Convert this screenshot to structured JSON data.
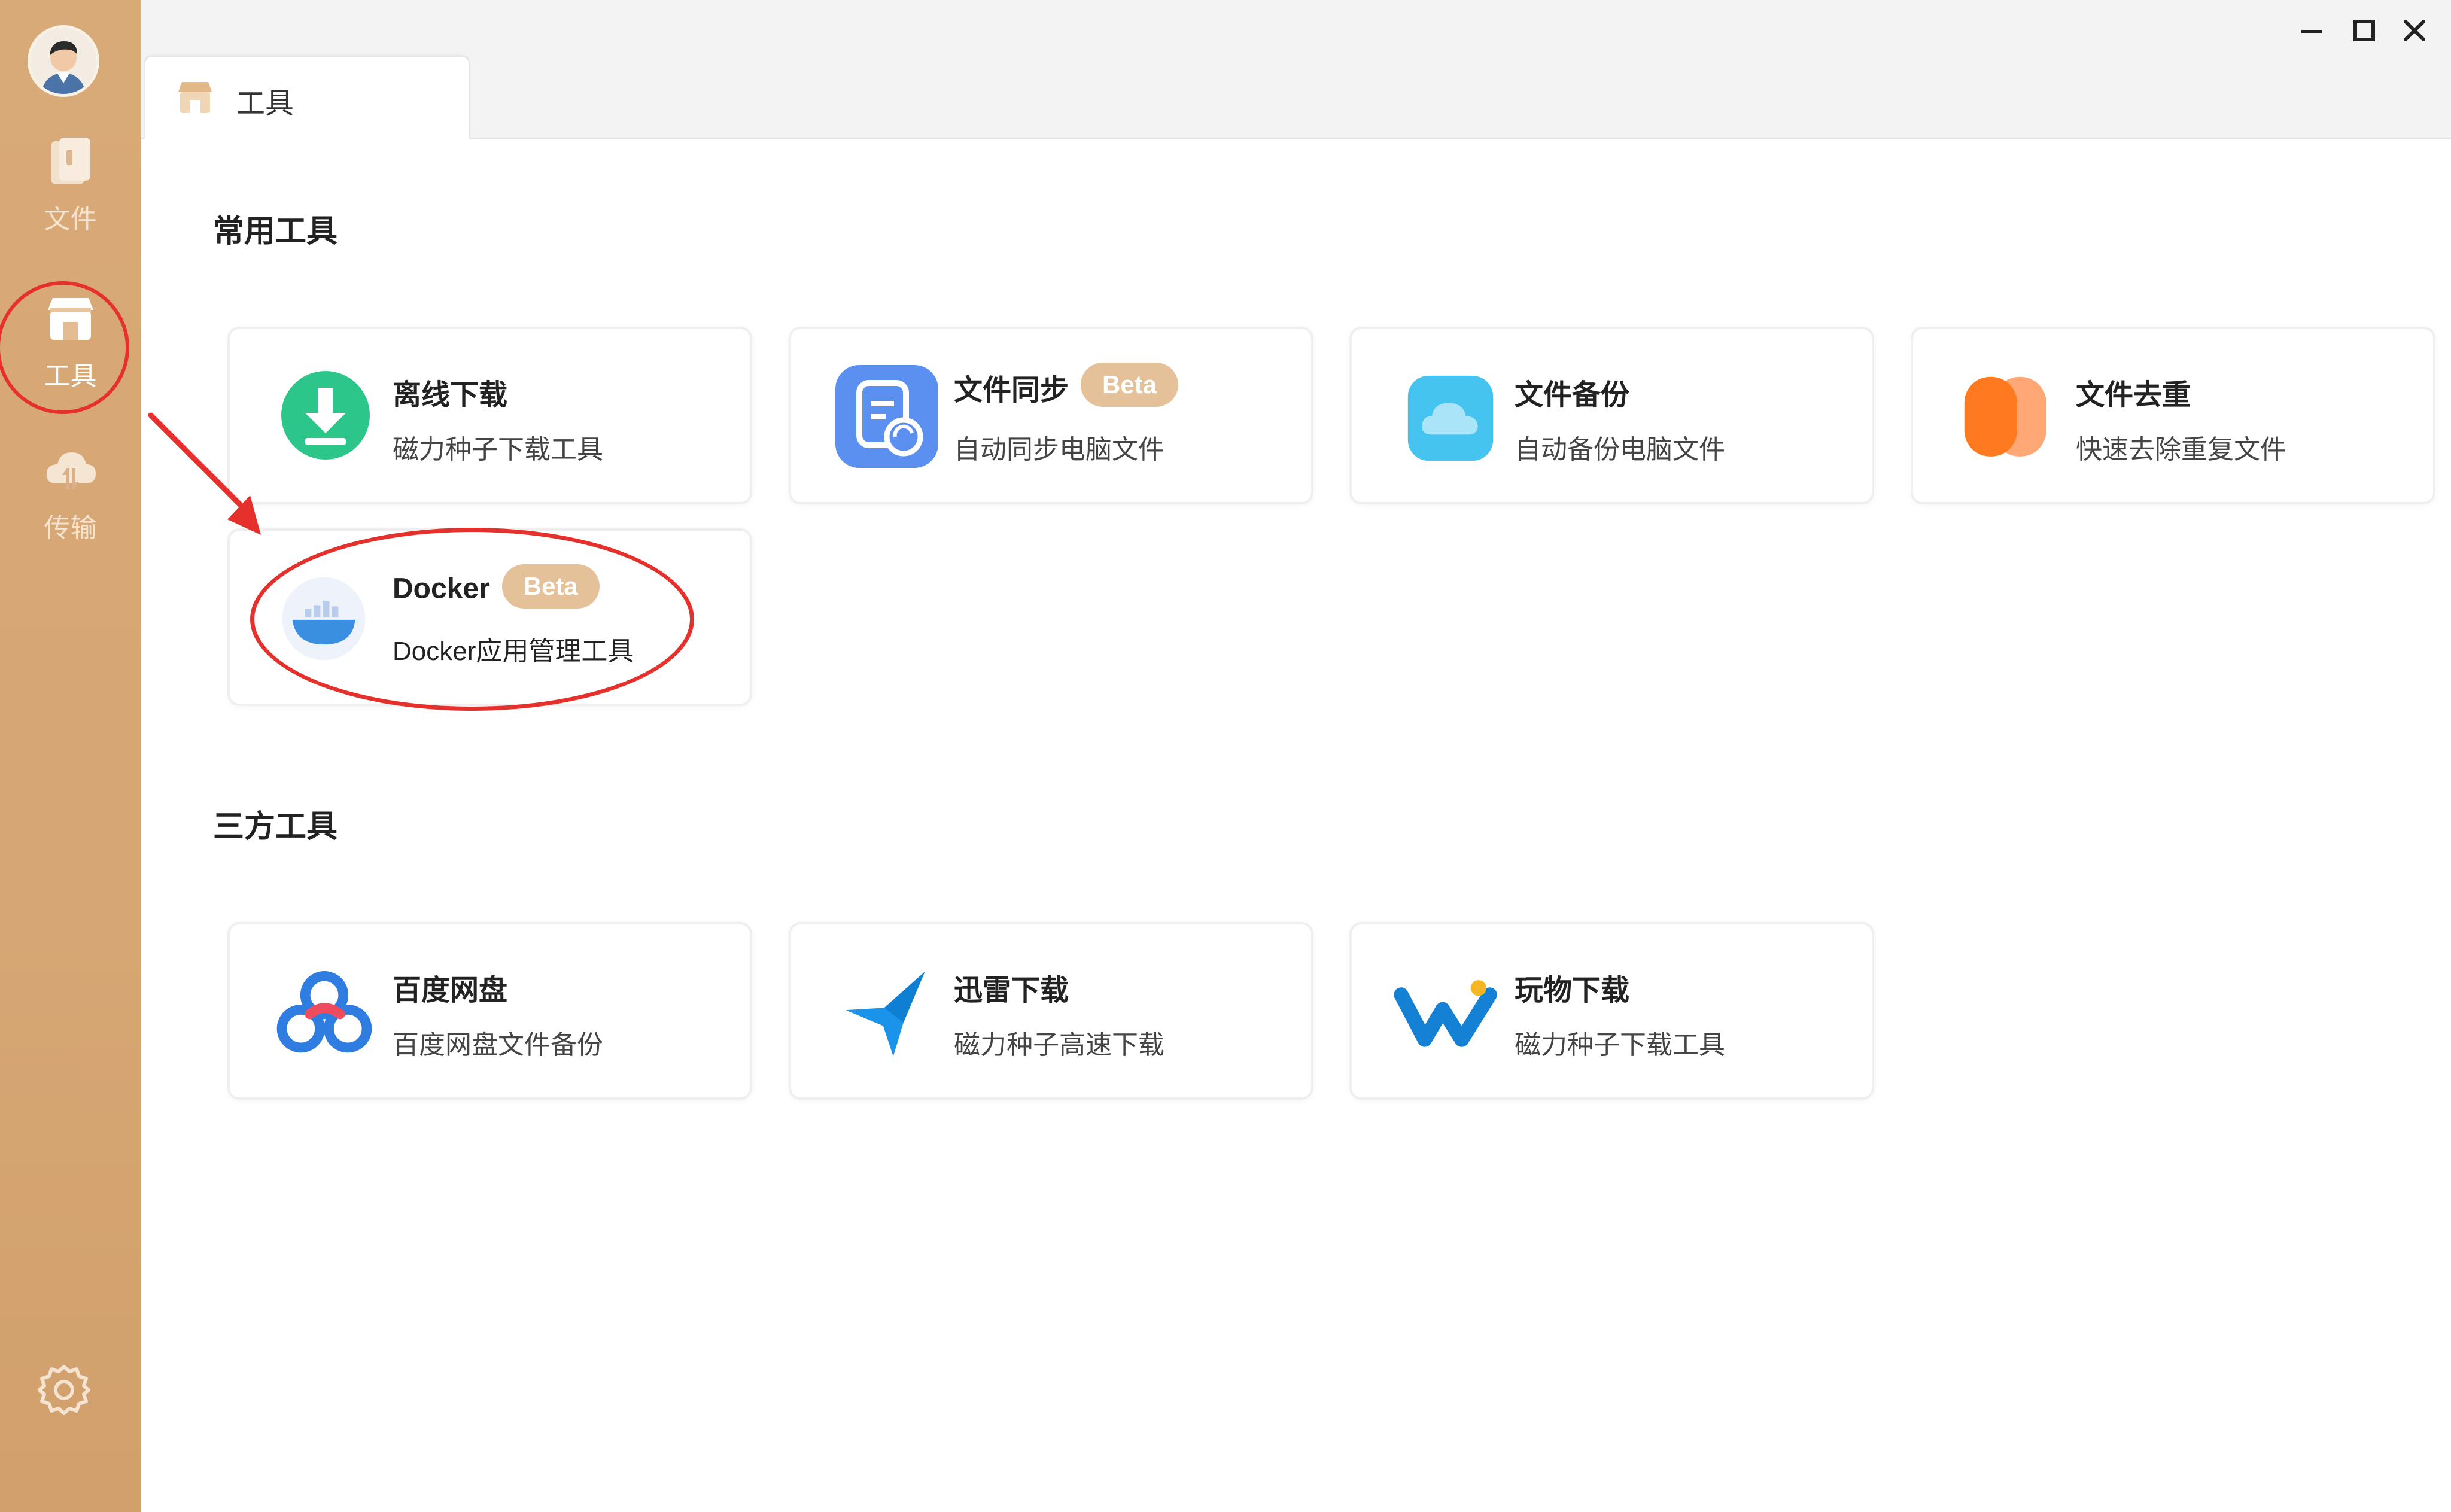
{
  "sidebar": {
    "items": [
      {
        "label": "文件",
        "icon": "file-icon"
      },
      {
        "label": "工具",
        "icon": "store-icon"
      },
      {
        "label": "传输",
        "icon": "cloud-transfer-icon"
      }
    ],
    "settings_icon": "settings-gear-icon"
  },
  "tabs": [
    {
      "label": "工具",
      "icon": "store-icon"
    }
  ],
  "window_controls": [
    "minimize",
    "maximize",
    "close"
  ],
  "sections": {
    "common": {
      "title": "常用工具",
      "cards": [
        {
          "title": "离线下载",
          "desc": "磁力种子下载工具",
          "icon": "download-icon",
          "color": "#2cc58a"
        },
        {
          "title": "文件同步",
          "badge": "Beta",
          "desc": "自动同步电脑文件",
          "icon": "file-sync-icon",
          "color": "#5b8ff0"
        },
        {
          "title": "文件备份",
          "desc": "自动备份电脑文件",
          "icon": "cloud-backup-icon",
          "color": "#45c4ef"
        },
        {
          "title": "文件去重",
          "desc": "快速去除重复文件",
          "icon": "dedupe-icon",
          "color": "#ff7a26"
        },
        {
          "title": "Docker",
          "badge": "Beta",
          "desc": "Docker应用管理工具",
          "icon": "docker-icon",
          "color": "#3a8fe0"
        }
      ]
    },
    "third": {
      "title": "三方工具",
      "cards": [
        {
          "title": "百度网盘",
          "desc": "百度网盘文件备份",
          "icon": "baidu-netdisk-icon"
        },
        {
          "title": "迅雷下载",
          "desc": "磁力种子高速下载",
          "icon": "xunlei-bird-icon"
        },
        {
          "title": "玩物下载",
          "desc": "磁力种子下载工具",
          "icon": "wanwu-icon"
        }
      ]
    }
  },
  "colors": {
    "sidebar": "#d6a674",
    "badge": "#e4c199",
    "annotation": "#e5302b"
  }
}
